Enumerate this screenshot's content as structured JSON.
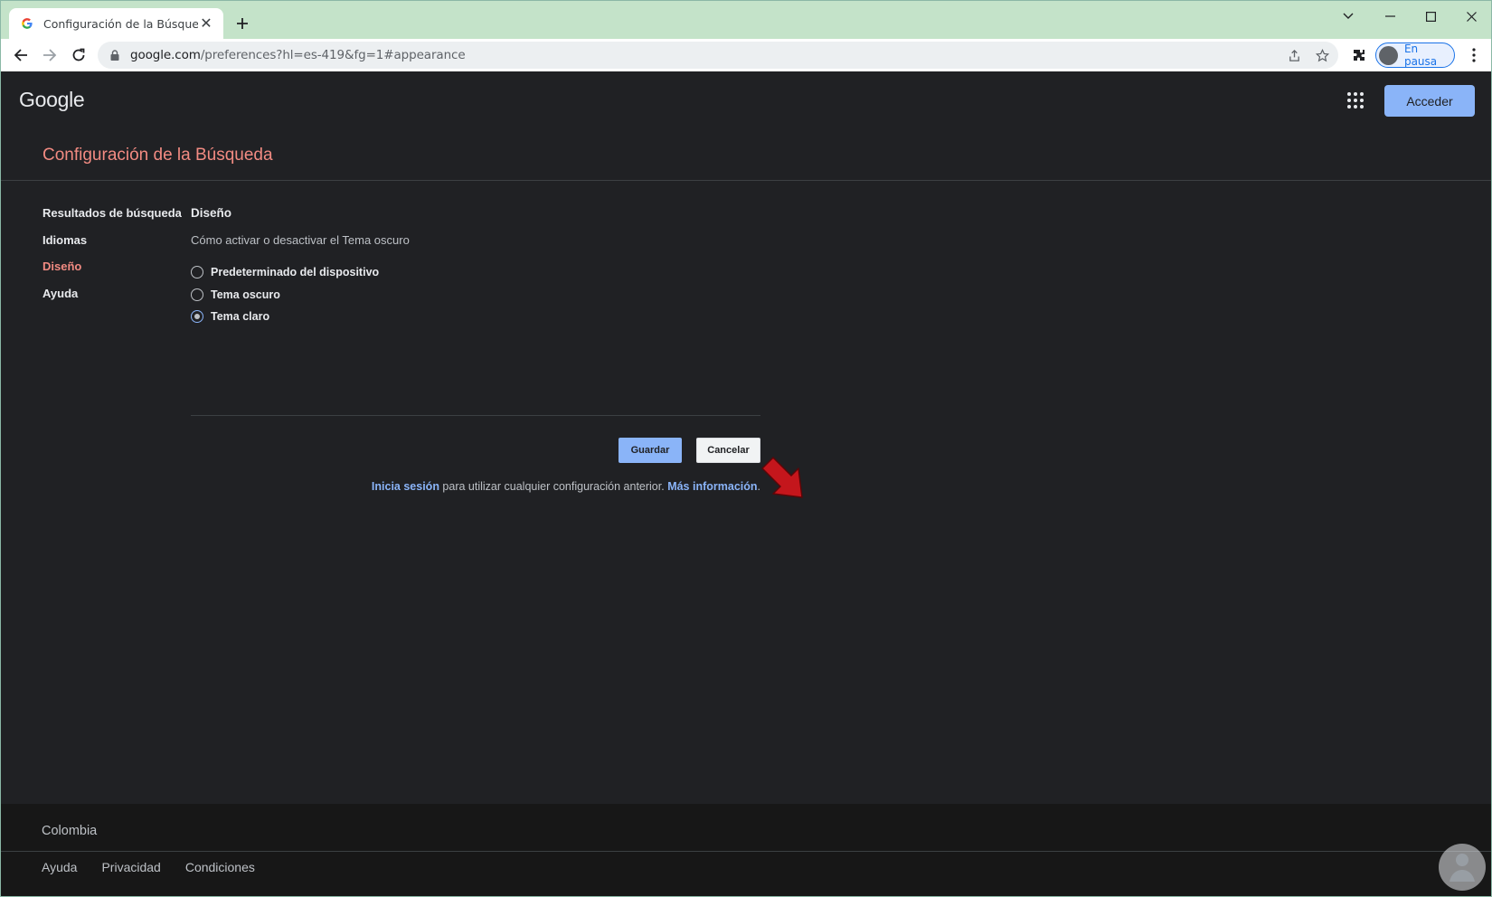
{
  "browser": {
    "tab_title": "Configuración de la Búsqueda",
    "url_host": "google.com",
    "url_path": "/preferences?hl=es-419&fg=1#appearance",
    "profile_label": "En pausa"
  },
  "header": {
    "logo_text": "Google",
    "signin_label": "Acceder"
  },
  "page_title": "Configuración de la Búsqueda",
  "sidebar": {
    "items": [
      {
        "label": "Resultados de búsqueda",
        "active": false
      },
      {
        "label": "Idiomas",
        "active": false
      },
      {
        "label": "Diseño",
        "active": true
      },
      {
        "label": "Ayuda",
        "active": false
      }
    ]
  },
  "section": {
    "title": "Diseño",
    "description": "Cómo activar o desactivar el Tema oscuro",
    "options": [
      {
        "label": "Predeterminado del dispositivo",
        "checked": false
      },
      {
        "label": "Tema oscuro",
        "checked": false
      },
      {
        "label": "Tema claro",
        "checked": true
      }
    ]
  },
  "actions": {
    "save_label": "Guardar",
    "cancel_label": "Cancelar"
  },
  "note": {
    "signin_link": "Inicia sesión",
    "middle_text": " para utilizar cualquier configuración anterior. ",
    "more_link": "Más información",
    "end": "."
  },
  "footer": {
    "country": "Colombia",
    "links": [
      "Ayuda",
      "Privacidad",
      "Condiciones"
    ]
  },
  "colors": {
    "page_bg": "#202124",
    "accent_red": "#f28b82",
    "accent_blue": "#8ab4f8",
    "titlebar": "#c4e3c9"
  }
}
